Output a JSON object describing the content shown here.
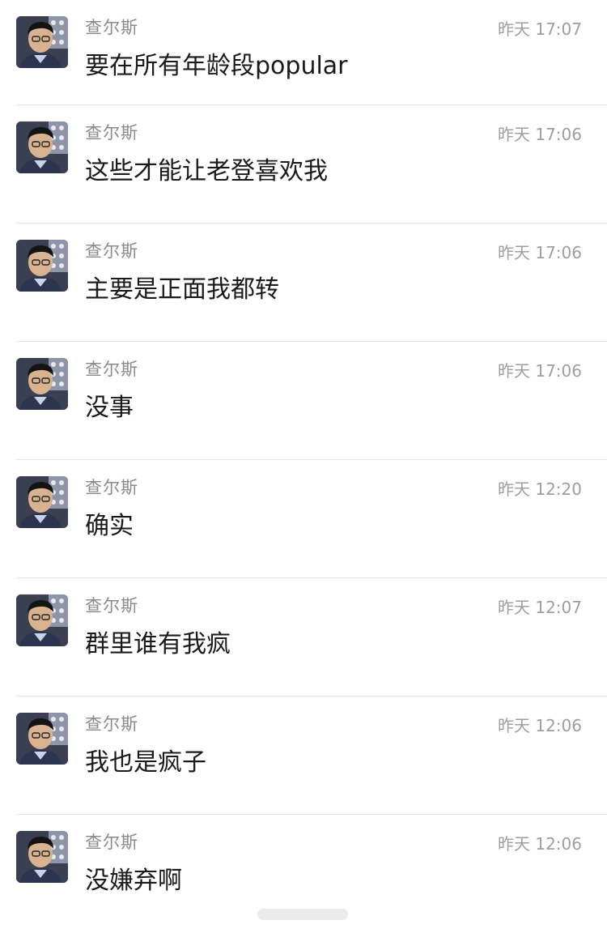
{
  "messages": [
    {
      "sender": "查尔斯",
      "time": "昨天 17:07",
      "text": "要在所有年龄段popular"
    },
    {
      "sender": "查尔斯",
      "time": "昨天 17:06",
      "text": "这些才能让老登喜欢我"
    },
    {
      "sender": "查尔斯",
      "time": "昨天 17:06",
      "text": "主要是正面我都转"
    },
    {
      "sender": "查尔斯",
      "time": "昨天 17:06",
      "text": "没事"
    },
    {
      "sender": "查尔斯",
      "time": "昨天 12:20",
      "text": "确实"
    },
    {
      "sender": "查尔斯",
      "time": "昨天 12:07",
      "text": "群里谁有我疯"
    },
    {
      "sender": "查尔斯",
      "time": "昨天 12:06",
      "text": "我也是疯子"
    },
    {
      "sender": "查尔斯",
      "time": "昨天 12:06",
      "text": "没嫌弃啊"
    }
  ],
  "colors": {
    "name": "#8a8a8a",
    "time": "#9e9e9e",
    "message": "#1a1a1a",
    "divider": "#e5e5e5",
    "background": "#ffffff"
  },
  "icons": {
    "avatar": "user-avatar-photo"
  }
}
